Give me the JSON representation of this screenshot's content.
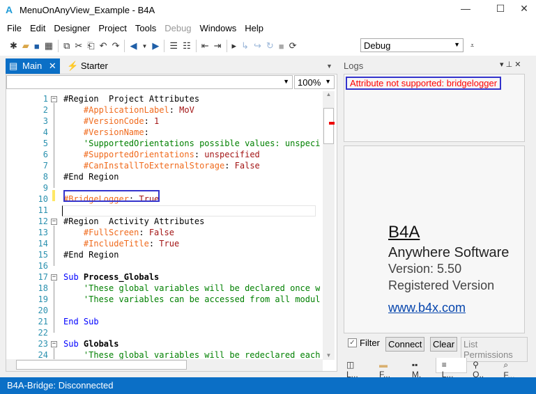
{
  "window": {
    "title": "MenuOnAnyView_Example - B4A",
    "logo": "A"
  },
  "menu": [
    {
      "label": "File"
    },
    {
      "label": "Edit"
    },
    {
      "label": "Designer"
    },
    {
      "label": "Project"
    },
    {
      "label": "Tools"
    },
    {
      "label": "Debug",
      "disabled": true
    },
    {
      "label": "Windows"
    },
    {
      "label": "Help"
    }
  ],
  "toolbar": {
    "config": "Debug"
  },
  "tabs": [
    {
      "label": "Main",
      "active": true
    },
    {
      "label": "Starter"
    }
  ],
  "editor": {
    "zoom": "100%",
    "module_select": "",
    "lines": [
      [
        [
          "#Region  Project Attributes",
          "k"
        ]
      ],
      [
        [
          "    #ApplicationLabel",
          "a"
        ],
        [
          ": ",
          "k"
        ],
        [
          "MoV",
          "v"
        ]
      ],
      [
        [
          "    #VersionCode",
          "a"
        ],
        [
          ": ",
          "k"
        ],
        [
          "1",
          "v"
        ]
      ],
      [
        [
          "    #VersionName",
          "a"
        ],
        [
          ":",
          "k"
        ]
      ],
      [
        [
          "    'SupportedOrientations possible values: unspecified",
          "c"
        ]
      ],
      [
        [
          "    #SupportedOrientations",
          "a"
        ],
        [
          ": ",
          "k"
        ],
        [
          "unspecified",
          "v"
        ]
      ],
      [
        [
          "    #CanInstallToExternalStorage",
          "a"
        ],
        [
          ": ",
          "k"
        ],
        [
          "False",
          "v"
        ]
      ],
      [
        [
          "#End Region",
          "k"
        ]
      ],
      [],
      [
        [
          "#BridgeLogger",
          "a"
        ],
        [
          ": ",
          "k"
        ],
        [
          "True",
          "v"
        ]
      ],
      [],
      [
        [
          "#Region  Activity Attributes",
          "k"
        ]
      ],
      [
        [
          "    #FullScreen",
          "a"
        ],
        [
          ": ",
          "k"
        ],
        [
          "False",
          "v"
        ]
      ],
      [
        [
          "    #IncludeTitle",
          "a"
        ],
        [
          ": ",
          "k"
        ],
        [
          "True",
          "v"
        ]
      ],
      [
        [
          "#End Region",
          "k"
        ]
      ],
      [],
      [
        [
          "Sub ",
          "b"
        ],
        [
          "Process_Globals",
          "bo"
        ]
      ],
      [
        [
          "    'These global variables will be declared once when",
          "c"
        ]
      ],
      [
        [
          "    'These variables can be accessed from all modules.",
          "c"
        ]
      ],
      [],
      [
        [
          "End Sub",
          "b"
        ]
      ],
      [],
      [
        [
          "Sub ",
          "b"
        ],
        [
          "Globals",
          "bo"
        ]
      ],
      [
        [
          "    'These global variables will be redeclared each time",
          "c"
        ]
      ]
    ]
  },
  "logs": {
    "title": "Logs",
    "message": "Attribute not supported: bridgelogger",
    "filter_label": "Filter",
    "filter_checked": true,
    "connect": "Connect",
    "clear": "Clear",
    "list_permissions": "List Permissions"
  },
  "about": {
    "product": "B4A",
    "company": "Anywhere Software",
    "version": "Version: 5.50",
    "registered": "Registered Version",
    "link": "www.b4x.com"
  },
  "bottom_tabs": [
    {
      "label": "L...",
      "icon": "book-icon"
    },
    {
      "label": "F...",
      "icon": "folder-icon"
    },
    {
      "label": "M.",
      "icon": "modules-icon"
    },
    {
      "label": "L...",
      "icon": "logs-icon",
      "active": true
    },
    {
      "label": "Q..",
      "icon": "search-icon"
    },
    {
      "label": "F...",
      "icon": "find-icon"
    }
  ],
  "status": {
    "text": "B4A-Bridge: Disconnected"
  },
  "colors": {
    "accent": "#0b6fc6",
    "highlight_box": "#3333cc",
    "error": "#ff0000"
  }
}
